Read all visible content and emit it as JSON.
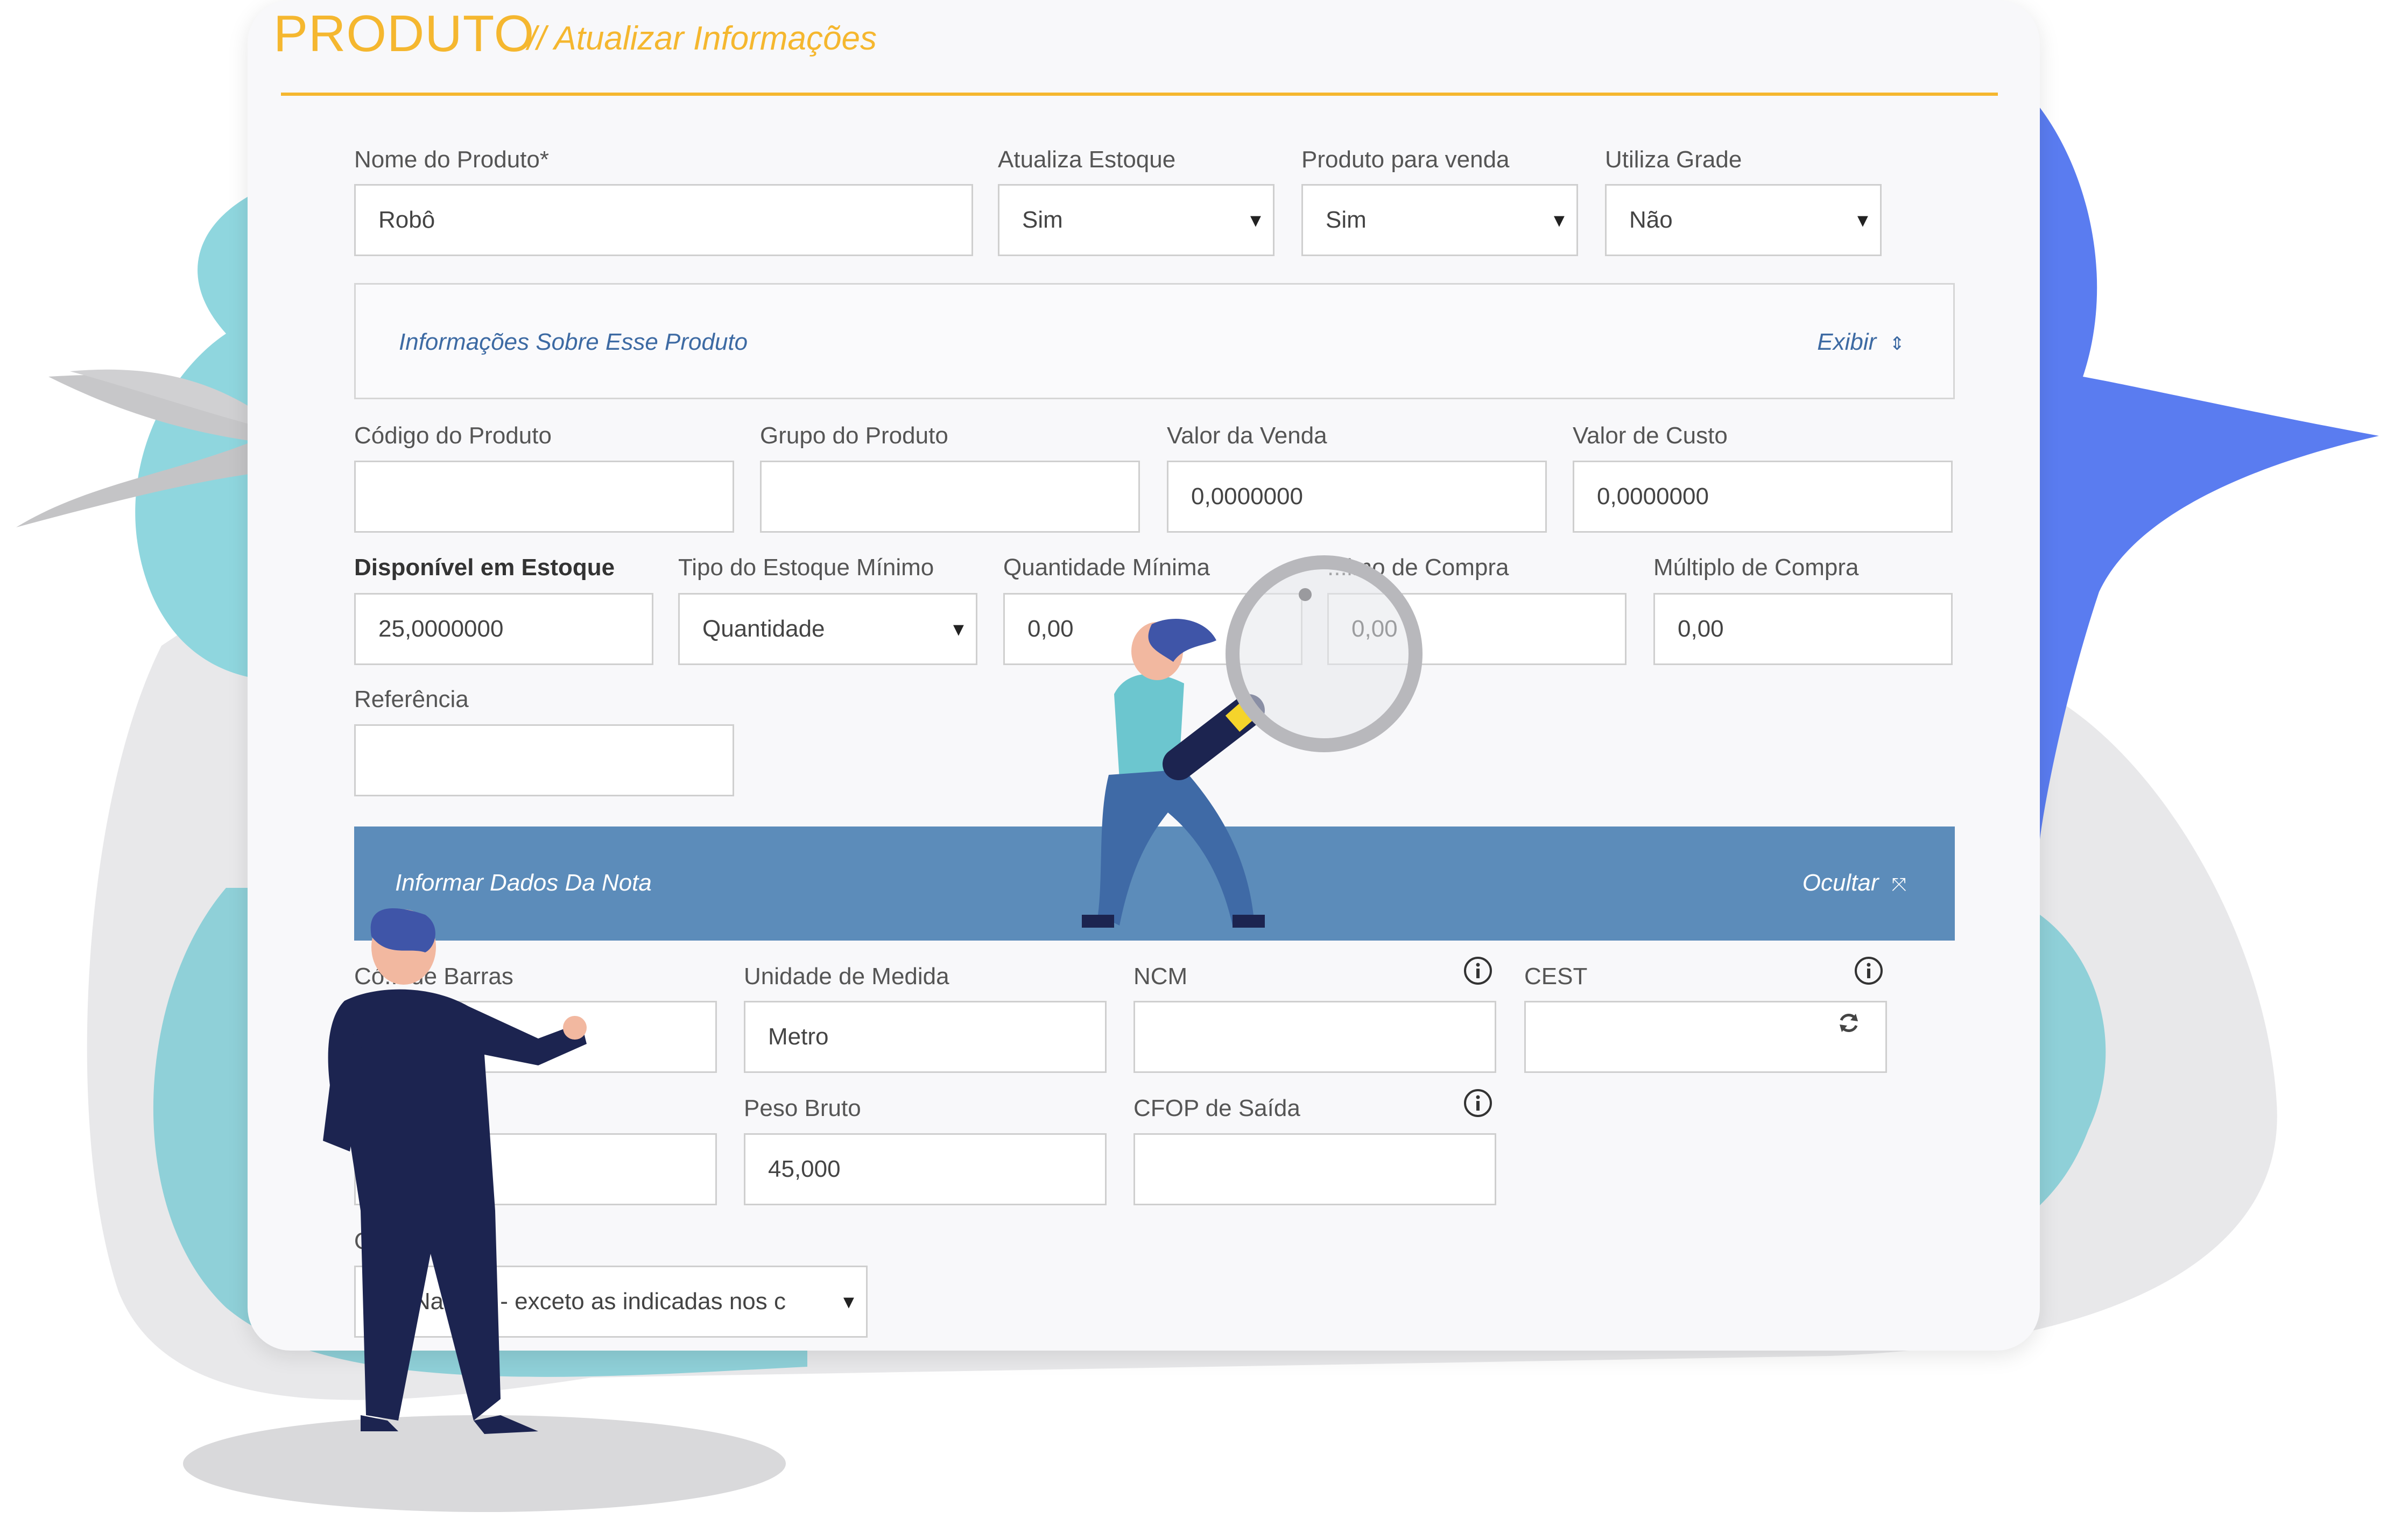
{
  "header": {
    "title": "PRODUTO",
    "subtitle": "// Atualizar Informações"
  },
  "fields": {
    "nome_produto": {
      "label": "Nome do Produto*",
      "value": "Robô"
    },
    "atualiza_estoque": {
      "label": "Atualiza Estoque",
      "value": "Sim"
    },
    "produto_venda": {
      "label": "Produto para venda",
      "value": "Sim"
    },
    "utiliza_grade": {
      "label": "Utiliza Grade",
      "value": "Não"
    },
    "codigo_produto": {
      "label": "Código do Produto",
      "value": ""
    },
    "grupo_produto": {
      "label": "Grupo do Produto",
      "value": ""
    },
    "valor_venda": {
      "label": "Valor da Venda",
      "value": "0,0000000"
    },
    "valor_custo": {
      "label": "Valor de Custo",
      "value": "0,0000000"
    },
    "disponivel_estoque": {
      "label": "Disponível em Estoque",
      "value": "25,0000000"
    },
    "tipo_estoque_minimo": {
      "label": "Tipo do Estoque Mínimo",
      "value": "Quantidade"
    },
    "quantidade_minima": {
      "label": "Quantidade Mínima",
      "value": "0,00"
    },
    "minimo_compra": {
      "label": "...imo de Compra",
      "value": "0,00"
    },
    "multiplo_compra": {
      "label": "Múltiplo de Compra",
      "value": "0,00"
    },
    "referencia": {
      "label": "Referência",
      "value": ""
    },
    "codigo_barras": {
      "label": "Có... de Barras",
      "value": ""
    },
    "unidade_medida": {
      "label": "Unidade de Medida",
      "value": "Metro"
    },
    "ncm": {
      "label": "NCM",
      "value": ""
    },
    "cest": {
      "label": "CEST",
      "value": ""
    },
    "peso_liquido": {
      "label": "...do",
      "value": ""
    },
    "peso_bruto": {
      "label": "Peso Bruto",
      "value": "45,000"
    },
    "cfop_saida": {
      "label": "CFOP de Saída",
      "value": ""
    },
    "origem": {
      "label": "O...em",
      "value": "- Nac...al - exceto as indicadas nos c"
    }
  },
  "panels": {
    "info": {
      "title": "Informações Sobre Esse Produto",
      "action": "Exibir"
    },
    "nota": {
      "title": "Informar Dados Da Nota",
      "action": "Ocultar"
    }
  },
  "colors": {
    "accent": "#f5b72f",
    "panel_dark": "#5c8cba",
    "panel_text": "#3d6aa3",
    "blob_teal": "#7fd0d9",
    "blob_blue": "#5b7ff2",
    "blob_gray": "#e6e6e8"
  },
  "icons": {
    "info": "info-circle-icon",
    "refresh": "refresh-icon",
    "chevron_expand": "chevron-up-down-icon",
    "chevron_collapse": "chevron-collapse-icon",
    "select_arrow": "caret-down-icon"
  }
}
